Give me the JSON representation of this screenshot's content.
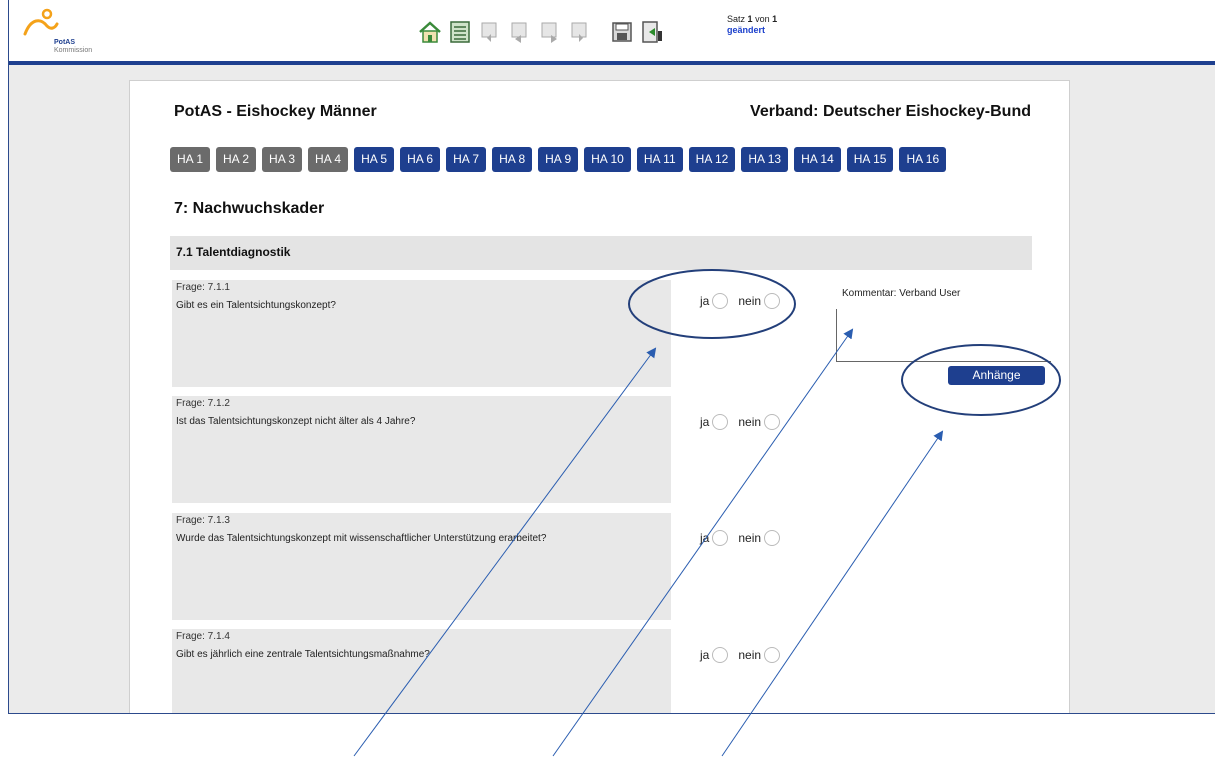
{
  "brand": {
    "name": "PotAS",
    "sub": "Kommission",
    "accent": "#1e3f8f",
    "logo_color": "#f4a21a"
  },
  "toolbar": {
    "icons": [
      "home-icon",
      "list-icon",
      "first-record-icon",
      "previous-record-icon",
      "next-record-icon",
      "last-record-icon",
      "save-icon",
      "exit-icon"
    ],
    "record_prefix": "Satz",
    "record_current": "1",
    "record_sep": "von",
    "record_total": "1",
    "status": "geändert"
  },
  "header": {
    "title": "PotAS - Eishockey Männer",
    "verband": "Verband: Deutscher Eishockey-Bund"
  },
  "tabs": [
    {
      "label": "HA 1",
      "state": "grey"
    },
    {
      "label": "HA 2",
      "state": "grey"
    },
    {
      "label": "HA 3",
      "state": "grey"
    },
    {
      "label": "HA 4",
      "state": "grey"
    },
    {
      "label": "HA 5",
      "state": "blue"
    },
    {
      "label": "HA 6",
      "state": "blue"
    },
    {
      "label": "HA 7",
      "state": "blue"
    },
    {
      "label": "HA 8",
      "state": "blue"
    },
    {
      "label": "HA 9",
      "state": "blue"
    },
    {
      "label": "HA 10",
      "state": "blue"
    },
    {
      "label": "HA 11",
      "state": "blue"
    },
    {
      "label": "HA 12",
      "state": "blue"
    },
    {
      "label": "HA 13",
      "state": "blue"
    },
    {
      "label": "HA 14",
      "state": "blue"
    },
    {
      "label": "HA 15",
      "state": "blue"
    },
    {
      "label": "HA 16",
      "state": "blue"
    }
  ],
  "section": {
    "title": "7: Nachwuchskader",
    "subsection": "7.1 Talentdiagnostik"
  },
  "questions": [
    {
      "label": "Frage: 7.1.1",
      "text": "Gibt es ein Talentsichtungskonzept?"
    },
    {
      "label": "Frage: 7.1.2",
      "text": "Ist das Talentsichtungskonzept nicht älter als 4 Jahre?"
    },
    {
      "label": "Frage: 7.1.3",
      "text": "Wurde das Talentsichtungskonzept mit wissenschaftlicher Unterstützung erarbeitet?"
    },
    {
      "label": "Frage: 7.1.4",
      "text": "Gibt es jährlich eine zentrale Talentsichtungsmaßnahme?"
    }
  ],
  "answers": {
    "yes": "ja",
    "no": "nein"
  },
  "comment": {
    "label": "Kommentar: Verband User"
  },
  "attachments_button": "Anhänge"
}
